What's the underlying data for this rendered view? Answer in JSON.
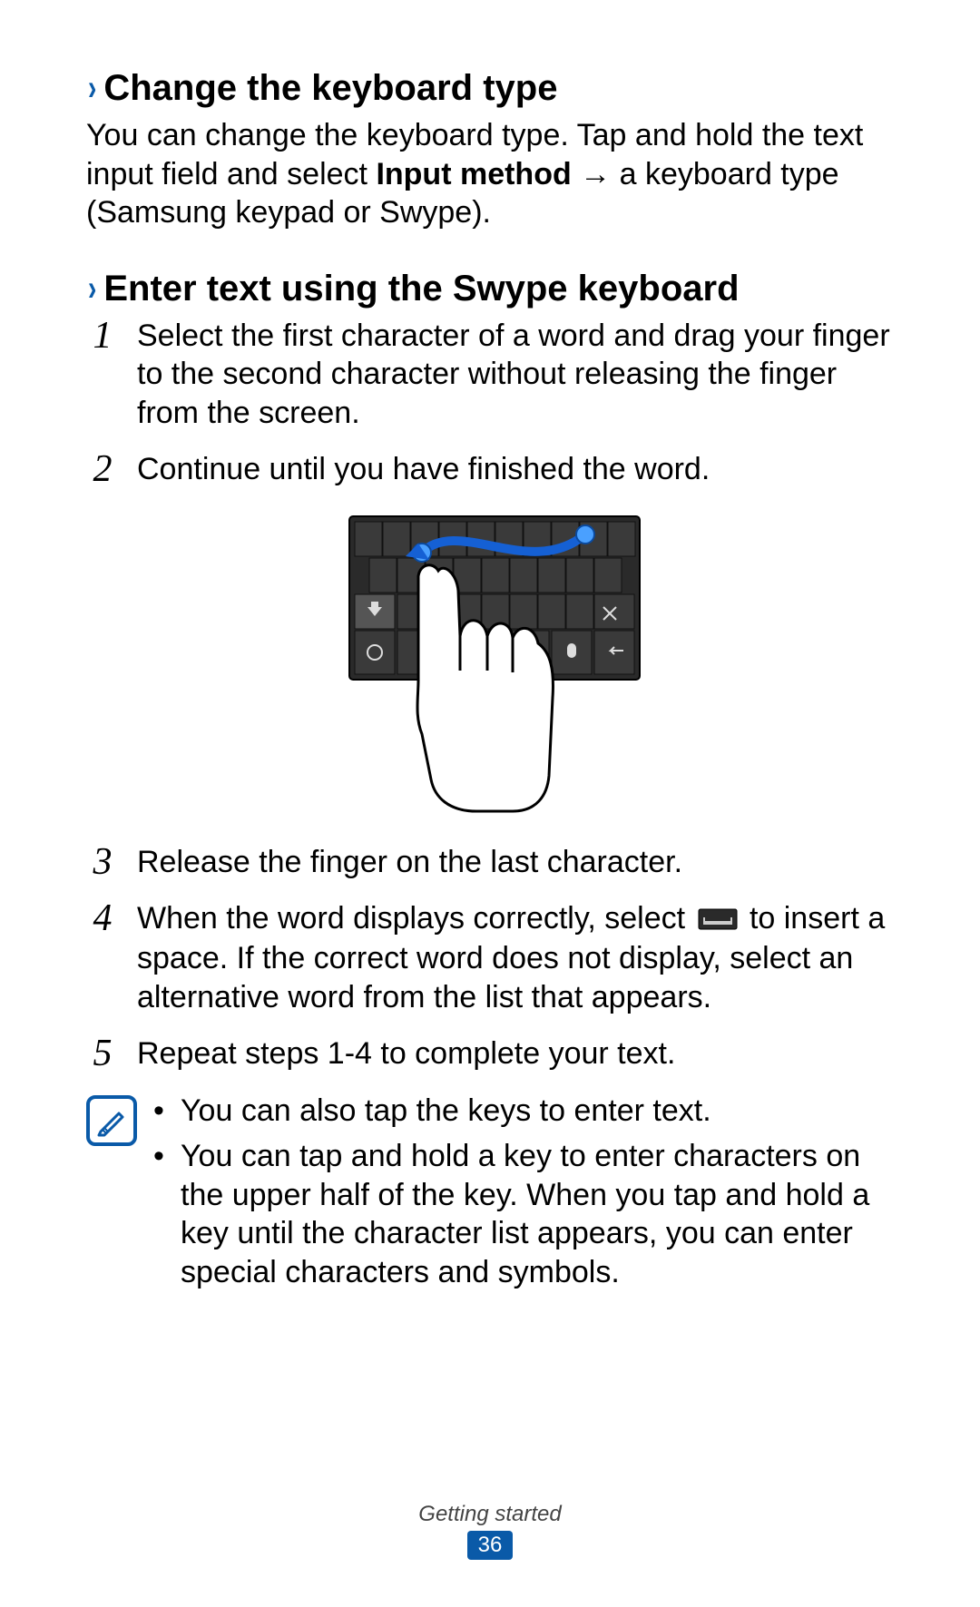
{
  "section1": {
    "heading": "Change the keyboard type",
    "paragraph_pre": "You can change the keyboard type. Tap and hold the text input field and select ",
    "paragraph_bold": "Input method",
    "paragraph_post": " → a keyboard type (Samsung keypad or Swype)."
  },
  "section2": {
    "heading": "Enter text using the Swype keyboard",
    "steps": {
      "s1": {
        "num": "1",
        "text": "Select the first character of a word and drag your finger to the second character without releasing the finger from the screen."
      },
      "s2": {
        "num": "2",
        "text": "Continue until you have finished the word."
      },
      "s3": {
        "num": "3",
        "text": "Release the finger on the last character."
      },
      "s4": {
        "num": "4",
        "pre": "When the word displays correctly, select ",
        "post": " to insert a space. If the correct word does not display, select an alternative word from the list that appears."
      },
      "s5": {
        "num": "5",
        "text": "Repeat steps 1-4 to complete your text."
      }
    },
    "notes": {
      "n1": "You can also tap the keys to enter text.",
      "n2": "You can tap and hold a key to enter characters on the upper half of the key. When you tap and hold a key until the character list appears, you can enter special characters and symbols."
    }
  },
  "footer": {
    "chapter": "Getting started",
    "page": "36"
  }
}
